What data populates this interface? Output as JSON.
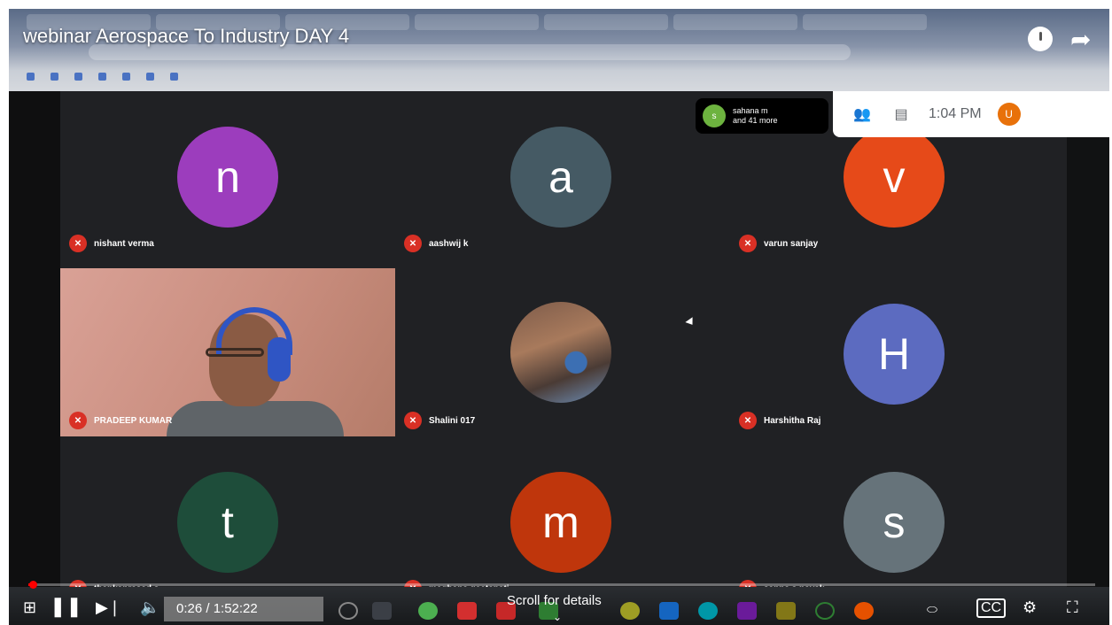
{
  "video": {
    "title": "webinar Aerospace To Industry DAY 4",
    "time_current": "0:26",
    "time_total": "1:52:22",
    "time_display": "0:26 / 1:52:22",
    "progress_fraction": 0.004,
    "scroll_hint": "Scroll for details"
  },
  "meet": {
    "clock": "1:04 PM",
    "others_line1": "sahana m",
    "others_line2": "and 41 more",
    "self_initial": "U"
  },
  "participants": [
    {
      "initial": "n",
      "name": "nishant verma",
      "color": "#9c3dbd"
    },
    {
      "initial": "a",
      "name": "aashwij k",
      "color": "#455a64"
    },
    {
      "initial": "v",
      "name": "varun sanjay",
      "color": "#e64a19"
    },
    {
      "initial": "",
      "name": "PRADEEP KUMAR",
      "color": "#c98d7e"
    },
    {
      "initial": "",
      "name": "Shalini 017",
      "color": "#7d5b4a"
    },
    {
      "initial": "H",
      "name": "Harshitha Raj",
      "color": "#5c6bc0"
    },
    {
      "initial": "t",
      "name": "thankaprasad s",
      "color": "#1e4d3a"
    },
    {
      "initial": "m",
      "name": "meghana geetapati",
      "color": "#bf360c"
    },
    {
      "initial": "s",
      "name": "sapna s nayak",
      "color": "#66737a"
    }
  ]
}
